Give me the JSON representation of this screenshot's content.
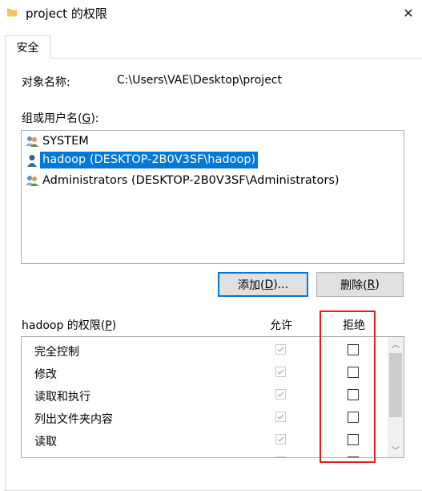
{
  "window": {
    "title": "project 的权限",
    "close_glyph": "✕"
  },
  "tabs": [
    {
      "label": "安全",
      "active": true
    }
  ],
  "object": {
    "label": "对象名称:",
    "value": "C:\\Users\\VAE\\Desktop\\project"
  },
  "group_label": {
    "before": "组或用户名(",
    "key": "G",
    "after": "):"
  },
  "users": [
    {
      "name": "SYSTEM",
      "icon": "users-group-icon",
      "selected": false
    },
    {
      "name": "hadoop (DESKTOP-2B0V3SF\\hadoop)",
      "icon": "user-icon",
      "selected": true
    },
    {
      "name": "Administrators (DESKTOP-2B0V3SF\\Administrators)",
      "icon": "users-group-icon",
      "selected": false
    }
  ],
  "buttons": {
    "add": {
      "before": "添加(",
      "key": "D",
      "after": ")..."
    },
    "remove": {
      "before": "删除(",
      "key": "R",
      "after": ")"
    }
  },
  "permissions": {
    "label_before": "hadoop 的权限(",
    "label_key": "P",
    "label_after": ")",
    "allow_header": "允许",
    "deny_header": "拒绝",
    "rows": [
      {
        "name": "完全控制",
        "allow": true,
        "deny": false
      },
      {
        "name": "修改",
        "allow": true,
        "deny": false
      },
      {
        "name": "读取和执行",
        "allow": true,
        "deny": false
      },
      {
        "name": "列出文件夹内容",
        "allow": true,
        "deny": false
      },
      {
        "name": "读取",
        "allow": true,
        "deny": false
      }
    ]
  },
  "colors": {
    "selection": "#0078d7",
    "highlight_box": "#e02020",
    "folder": "#e8b84a"
  }
}
